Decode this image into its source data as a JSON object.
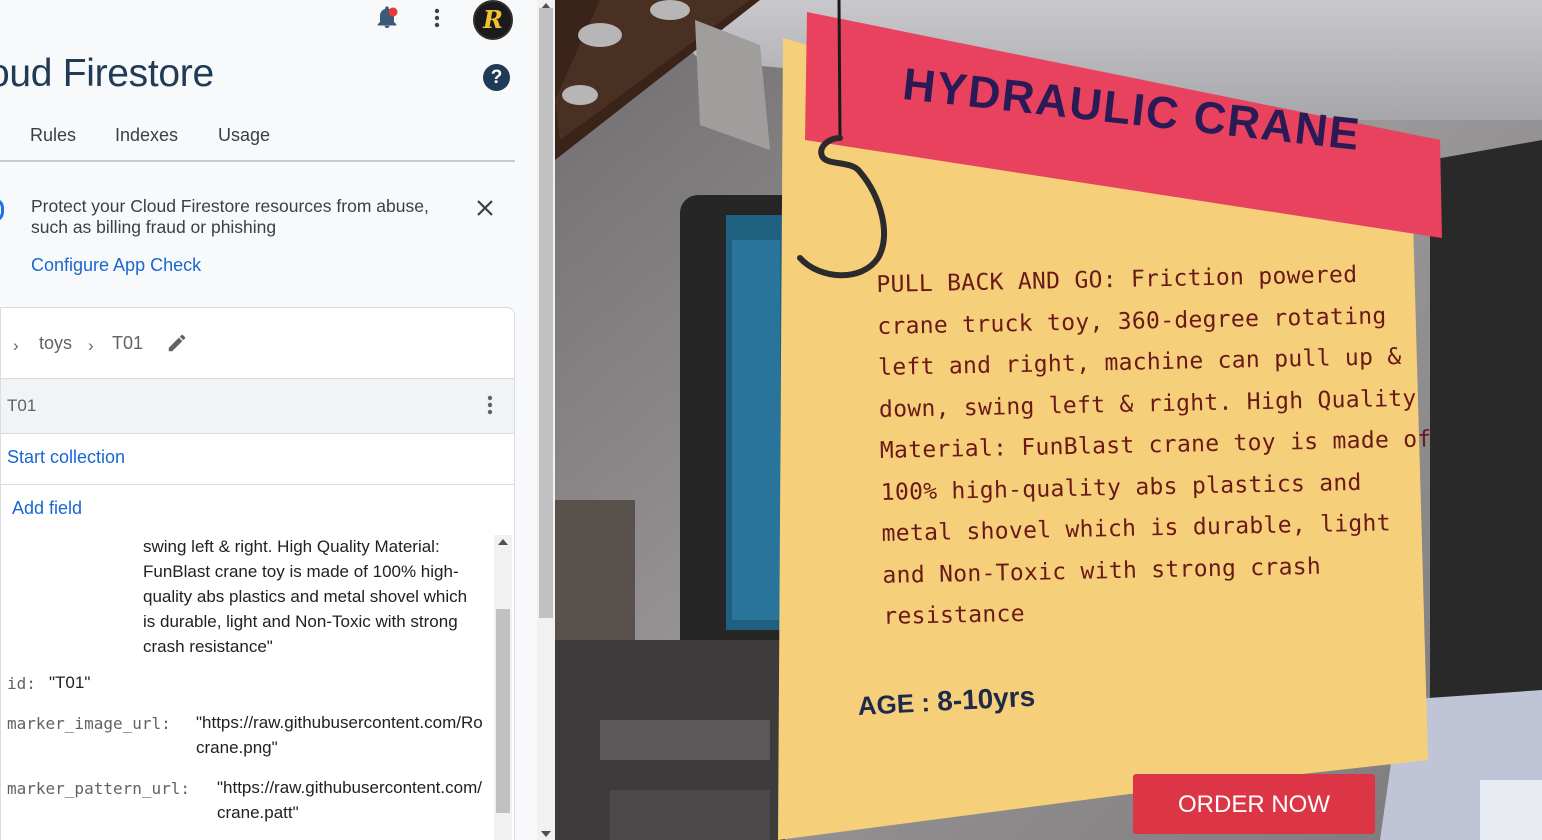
{
  "header": {
    "page_title": "oud Firestore",
    "help_label": "?"
  },
  "tabs": [
    {
      "label": "Rules"
    },
    {
      "label": "Indexes"
    },
    {
      "label": "Usage"
    }
  ],
  "banner": {
    "message": "Protect your Cloud Firestore resources from abuse, such as billing fraud or phishing",
    "link": "Configure App Check"
  },
  "breadcrumb": {
    "collection": "toys",
    "document": "T01"
  },
  "document": {
    "id": "T01",
    "start_collection": "Start collection",
    "add_field": "Add field",
    "description_tail": "swing left & right. High Quality Material: FunBlast crane toy is made of 100% high-quality abs plastics and metal shovel which is durable, light and Non-Toxic with strong crash resistance\"",
    "fields": [
      {
        "key": "id:",
        "value": "\"T01\""
      },
      {
        "key": "marker_image_url:",
        "value": "\"https://raw.githubusercontent.com/Ro",
        "value2": "crane.png\""
      },
      {
        "key": "marker_pattern_url:",
        "value": "\"https://raw.githubusercontent.com/",
        "value2": "crane.patt\""
      }
    ]
  },
  "ar_sign": {
    "title": "HYDRAULIC CRANE",
    "description": "PULL BACK AND GO: Friction powered crane truck toy, 360-degree rotating left and right, machine can pull up & down, swing left & right. High Quality Material: FunBlast crane toy is made of 100% high-quality abs plastics and metal shovel which is durable, light and Non-Toxic with strong crash resistance",
    "age_label": "AGE : ",
    "age_value": "8-10yrs",
    "order_button": "ORDER NOW"
  },
  "colors": {
    "firebase_title": "#1f3b57",
    "link_blue": "#1967d2",
    "sign_banner": "#e8425f",
    "sign_body": "#f6cf7a",
    "order_button": "#dc3545"
  },
  "icons": [
    "bell-icon",
    "more-vert-icon",
    "avatar",
    "help-icon",
    "close-icon",
    "chevron-right-icon",
    "pencil-icon",
    "hook-icon"
  ]
}
